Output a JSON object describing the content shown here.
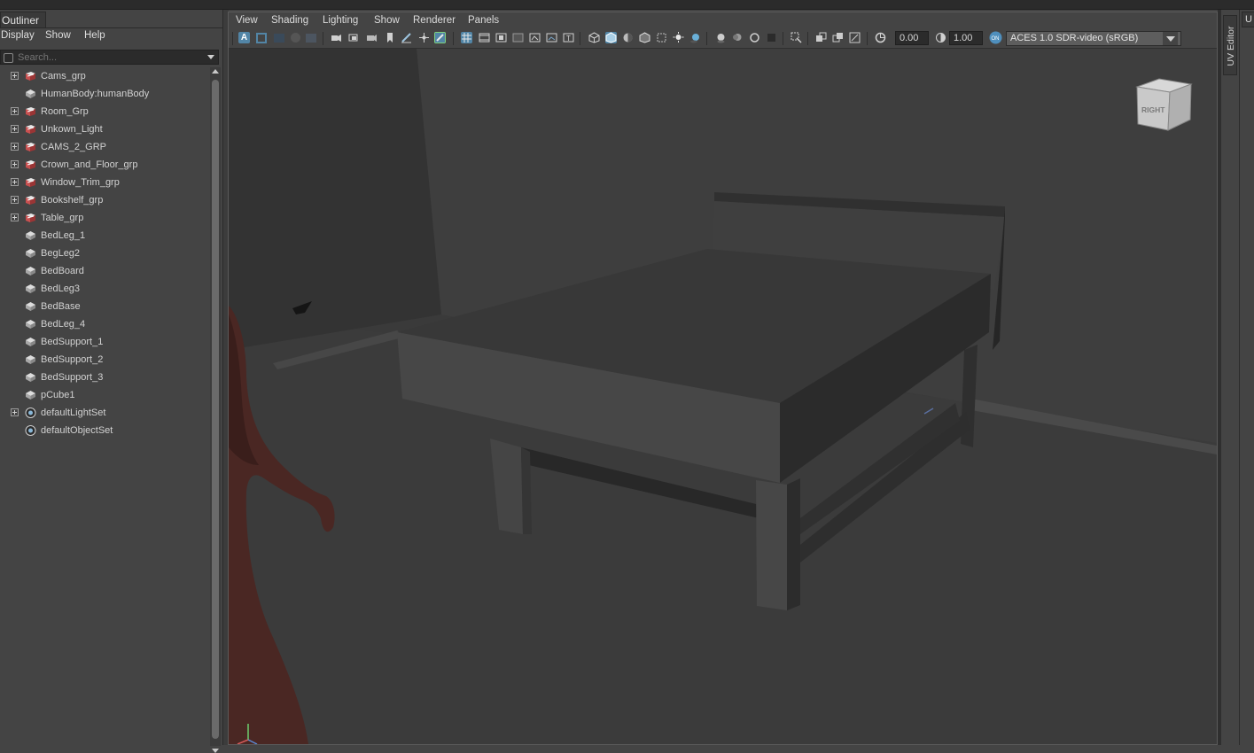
{
  "outliner": {
    "tab": "Outliner",
    "menu": [
      "Display",
      "Show",
      "Help"
    ],
    "search_placeholder": "Search...",
    "items": [
      {
        "label": "Cams_grp",
        "expand": true,
        "icon": "group-icon"
      },
      {
        "label": "HumanBody:humanBody",
        "expand": false,
        "icon": "mesh-icon"
      },
      {
        "label": "Room_Grp",
        "expand": true,
        "icon": "group-icon"
      },
      {
        "label": "Unkown_Light",
        "expand": true,
        "icon": "group-icon"
      },
      {
        "label": "CAMS_2_GRP",
        "expand": true,
        "icon": "group-icon"
      },
      {
        "label": "Crown_and_Floor_grp",
        "expand": true,
        "icon": "group-icon"
      },
      {
        "label": "Window_Trim_grp",
        "expand": true,
        "icon": "group-icon"
      },
      {
        "label": "Bookshelf_grp",
        "expand": true,
        "icon": "group-icon"
      },
      {
        "label": "Table_grp",
        "expand": true,
        "icon": "group-icon"
      },
      {
        "label": "BedLeg_1",
        "expand": false,
        "icon": "mesh-icon"
      },
      {
        "label": "BegLeg2",
        "expand": false,
        "icon": "mesh-icon"
      },
      {
        "label": "BedBoard",
        "expand": false,
        "icon": "mesh-icon"
      },
      {
        "label": "BedLeg3",
        "expand": false,
        "icon": "mesh-icon"
      },
      {
        "label": "BedBase",
        "expand": false,
        "icon": "mesh-icon"
      },
      {
        "label": "BedLeg_4",
        "expand": false,
        "icon": "mesh-icon"
      },
      {
        "label": "BedSupport_1",
        "expand": false,
        "icon": "mesh-icon"
      },
      {
        "label": "BedSupport_2",
        "expand": false,
        "icon": "mesh-icon"
      },
      {
        "label": "BedSupport_3",
        "expand": false,
        "icon": "mesh-icon"
      },
      {
        "label": "pCube1",
        "expand": false,
        "icon": "mesh-icon"
      },
      {
        "label": "defaultLightSet",
        "expand": true,
        "icon": "set-icon"
      },
      {
        "label": "defaultObjectSet",
        "expand": false,
        "icon": "set-icon"
      }
    ]
  },
  "viewport": {
    "menu": [
      "View",
      "Shading",
      "Lighting",
      "Show",
      "Renderer",
      "Panels"
    ],
    "exposure": "0.00",
    "gamma": "1.00",
    "color_space": "ACES 1.0 SDR-video (sRGB)",
    "view_cube_label": "RIGHT"
  },
  "side_panel": {
    "uv_editor_tab": "UV Editor",
    "cut_tab": "U"
  },
  "colors": {
    "accent": "#5285a6",
    "group_icon": "#b84a4a",
    "panel_bg": "#444444",
    "viewport_bg": "#3a3a3a"
  }
}
